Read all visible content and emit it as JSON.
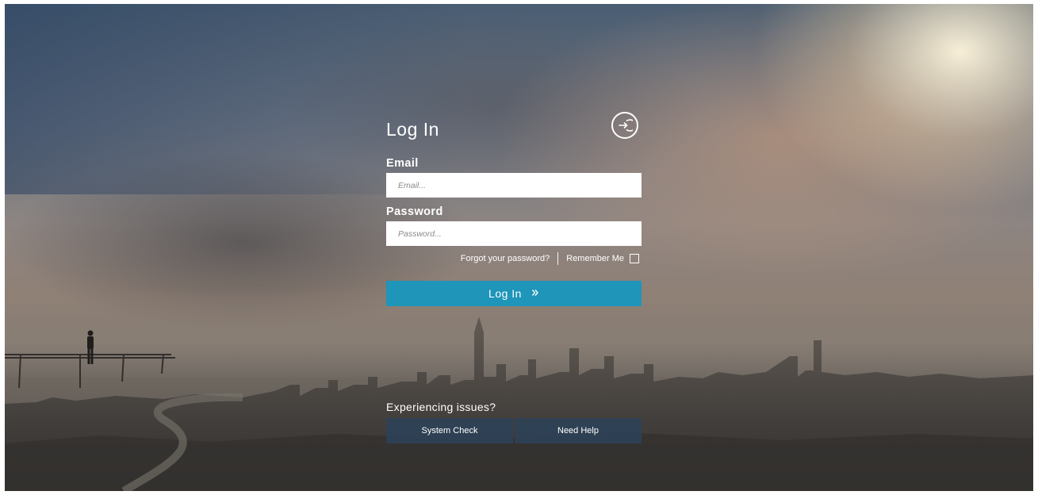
{
  "login": {
    "title": "Log In",
    "icon": "login-arrow-circle-icon",
    "email_label": "Email",
    "email_placeholder": "Email...",
    "password_label": "Password",
    "password_placeholder": "Password...",
    "forgot_password": "Forgot your password?",
    "remember_me": "Remember Me",
    "remember_checked": false,
    "submit_label": "Log In",
    "submit_icon": "double-chevron-right-icon",
    "accent_color": "#1e95b9"
  },
  "issues": {
    "title": "Experiencing issues?",
    "buttons": [
      "System Check",
      "Need Help"
    ],
    "button_color": "#2c425a"
  }
}
